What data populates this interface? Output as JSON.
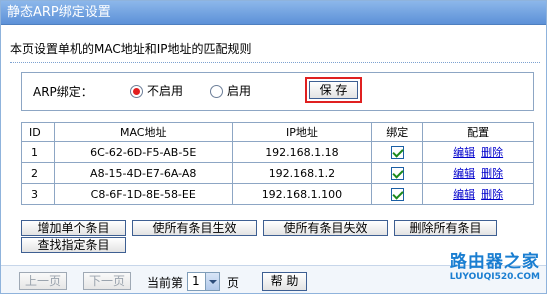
{
  "title": "静态ARP绑定设置",
  "intro": "本页设置单机的MAC地址和IP地址的匹配规则",
  "arp": {
    "label": "ARP绑定：",
    "options": [
      "不启用",
      "启用"
    ],
    "selected": "不启用",
    "save_label": "保 存"
  },
  "table": {
    "headers": [
      "ID",
      "MAC地址",
      "IP地址",
      "绑定",
      "配置"
    ],
    "rows": [
      {
        "id": "1",
        "mac": "6C-62-6D-F5-AB-5E",
        "ip": "192.168.1.18",
        "bound": true,
        "edit": "编辑",
        "delete": "删除"
      },
      {
        "id": "2",
        "mac": "A8-15-4D-E7-6A-A8",
        "ip": "192.168.1.2",
        "bound": true,
        "edit": "编辑",
        "delete": "删除"
      },
      {
        "id": "3",
        "mac": "C8-6F-1D-8E-58-EE",
        "ip": "192.168.1.100",
        "bound": true,
        "edit": "编辑",
        "delete": "删除"
      }
    ]
  },
  "actions": {
    "add_single": "增加单个条目",
    "enable_all": "使所有条目生效",
    "disable_all": "使所有条目失效",
    "delete_all": "删除所有条目",
    "find": "查找指定条目"
  },
  "footer": {
    "prev": "上一页",
    "next": "下一页",
    "current_prefix": "当前第",
    "page": "1",
    "page_suffix": "页",
    "help": "帮 助"
  },
  "watermark": {
    "text": "路由器之家",
    "url": "LUYOUQI520.COM"
  },
  "colors": {
    "title_bar": "#5d91d8",
    "selected_radio": "#e21f1f",
    "save_highlight": "#e02020",
    "link": "#0000cc"
  }
}
